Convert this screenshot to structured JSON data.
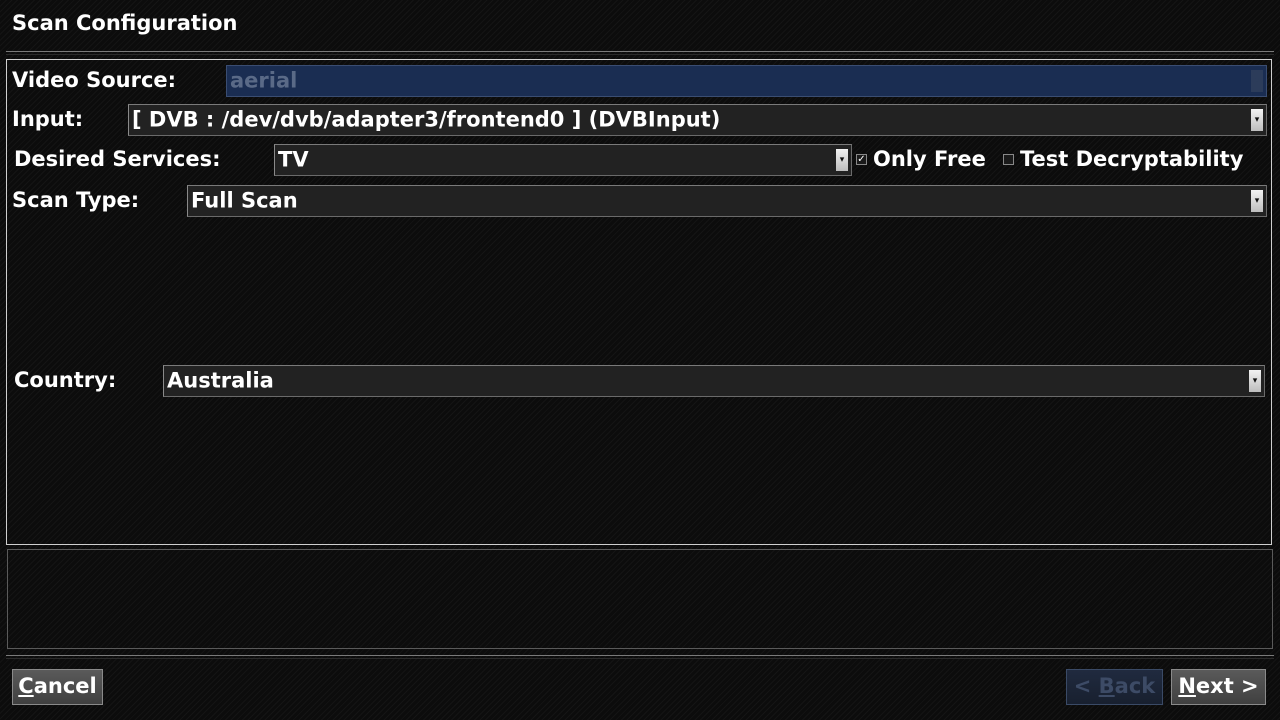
{
  "header": {
    "title": "Scan Configuration"
  },
  "form": {
    "video_source": {
      "label": "Video Source:",
      "value": "aerial"
    },
    "input": {
      "label": "Input:",
      "value": "[ DVB : /dev/dvb/adapter3/frontend0 ] (DVBInput)"
    },
    "desired_services": {
      "label": "Desired Services:",
      "value": "TV"
    },
    "only_free": {
      "label": "Only Free",
      "checked": true,
      "mark": "✓"
    },
    "test_decryptability": {
      "label": "Test Decryptability",
      "checked": false
    },
    "scan_type": {
      "label": "Scan Type:",
      "value": "Full Scan"
    },
    "country": {
      "label": "Country:",
      "value": "Australia"
    }
  },
  "footer": {
    "cancel": {
      "accel": "C",
      "rest": "ancel"
    },
    "back": {
      "text": "< ",
      "accel": "B",
      "rest": "ack"
    },
    "next": {
      "accel": "N",
      "rest": "ext >"
    }
  },
  "icons": {
    "dropdown": "▾",
    "colors": {
      "disabled_bg": "#1a2d52",
      "panel_border": "#cfcfcf"
    }
  }
}
